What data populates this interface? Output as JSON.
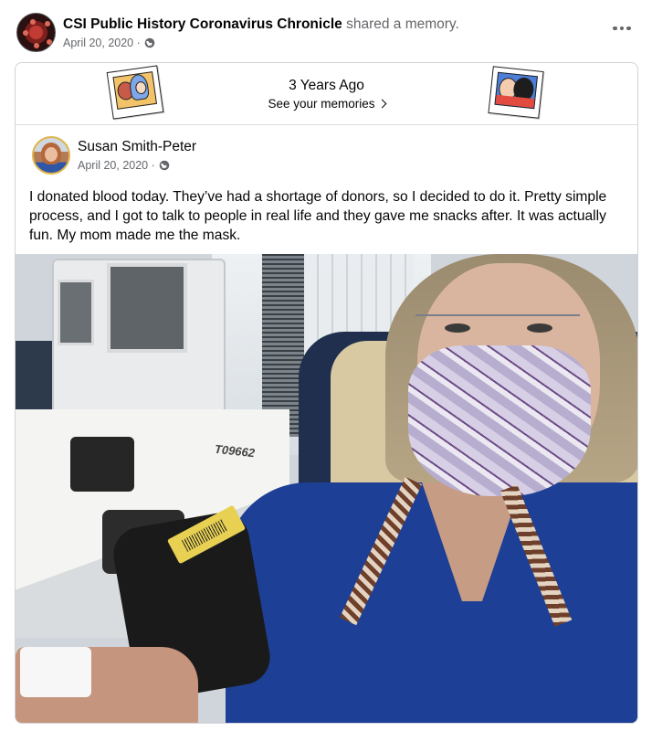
{
  "header": {
    "page_name": "CSI Public History Coronavirus Chronicle",
    "action_text": "shared a memory.",
    "date": "April 20, 2020 ·",
    "privacy_icon": "globe-icon",
    "more_icon": "more-options-icon"
  },
  "memory": {
    "title": "3 Years Ago",
    "link_label": "See your memories"
  },
  "post": {
    "author": "Susan Smith-Peter",
    "date": "April 20, 2020 ·",
    "text": "I donated blood today. They’ve had a shortage of donors, so I decided to do it.  Pretty simple process, and I got to talk to people in real life and they gave me snacks after.  It was actually fun.  My mom made me the mask."
  },
  "photo": {
    "machine_label": "T09662"
  },
  "colors": {
    "text_primary": "#050505",
    "text_secondary": "#65676b",
    "border": "#d0d3d7"
  }
}
